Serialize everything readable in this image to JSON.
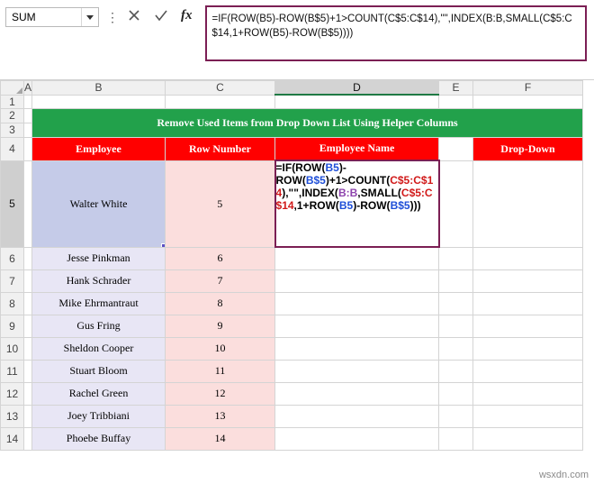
{
  "app": {
    "name_box_value": "SUM",
    "name_box_icon": "chevron-down-icon",
    "menu_dots": "⋮",
    "cancel_icon": "close-icon",
    "confirm_icon": "check-icon",
    "function_icon": "fx",
    "formula_bar_text": "=IF(ROW(B5)-ROW(B$5)+1>COUNT(C$5:C$14),\"\",INDEX(B:B,SMALL(C$5:C$14,1+ROW(B5)-ROW(B$5))))",
    "watermark": "wsxdn.com"
  },
  "grid": {
    "column_headers": [
      "A",
      "B",
      "C",
      "D",
      "E",
      "F"
    ],
    "selected_column": "D",
    "row_headers": [
      "1",
      "2",
      "3",
      "4",
      "5",
      "6",
      "7",
      "8",
      "9",
      "10",
      "11",
      "12",
      "13",
      "14"
    ],
    "selected_row": "5",
    "title": "Remove Used Items from Drop Down List Using Helper Columns",
    "headers": {
      "b": "Employee",
      "c": "Row Number",
      "d": "Employee Name",
      "f": "Drop-Down"
    },
    "active_cell_value": "Walter White",
    "active_cell_row_number": "5",
    "formula_cell_parts": [
      {
        "t": "=IF(ROW(",
        "c": "black"
      },
      {
        "t": "B5",
        "c": "blue"
      },
      {
        "t": ")-ROW(",
        "c": "black"
      },
      {
        "t": "B$5",
        "c": "blue"
      },
      {
        "t": ")",
        "c": "black"
      },
      {
        "t": "+1>COUNT(",
        "c": "black"
      },
      {
        "t": "C$5:C$14",
        "c": "red"
      },
      {
        "t": "),",
        "c": "black"
      },
      {
        "t": "\"\",INDEX(",
        "c": "black"
      },
      {
        "t": "B:B",
        "c": "purple"
      },
      {
        "t": ",SMALL(",
        "c": "black"
      },
      {
        "t": "C$5:C$14",
        "c": "red"
      },
      {
        "t": ",1+ROW(",
        "c": "black"
      },
      {
        "t": "B5",
        "c": "blue"
      },
      {
        "t": ")-",
        "c": "black"
      },
      {
        "t": "ROW(",
        "c": "black"
      },
      {
        "t": "B$5",
        "c": "blue"
      },
      {
        "t": ")))",
        "c": "black"
      }
    ],
    "rows": [
      {
        "row": "6",
        "name": "Jesse Pinkman",
        "num": "6"
      },
      {
        "row": "7",
        "name": "Hank Schrader",
        "num": "7"
      },
      {
        "row": "8",
        "name": "Mike Ehrmantraut",
        "num": "8"
      },
      {
        "row": "9",
        "name": "Gus Fring",
        "num": "9"
      },
      {
        "row": "10",
        "name": "Sheldon Cooper",
        "num": "10"
      },
      {
        "row": "11",
        "name": "Stuart Bloom",
        "num": "11"
      },
      {
        "row": "12",
        "name": "Rachel Green",
        "num": "12"
      },
      {
        "row": "13",
        "name": "Joey Tribbiani",
        "num": "13"
      },
      {
        "row": "14",
        "name": "Phoebe Buffay",
        "num": "14"
      }
    ]
  },
  "colors": {
    "title_bg": "#22a14b",
    "header_bg": "#ff0000",
    "name_bg": "#e8e6f5",
    "number_bg": "#fbdedd",
    "formula_border": "#7b1f54",
    "active_cell_bg": "#c5cbe8"
  }
}
